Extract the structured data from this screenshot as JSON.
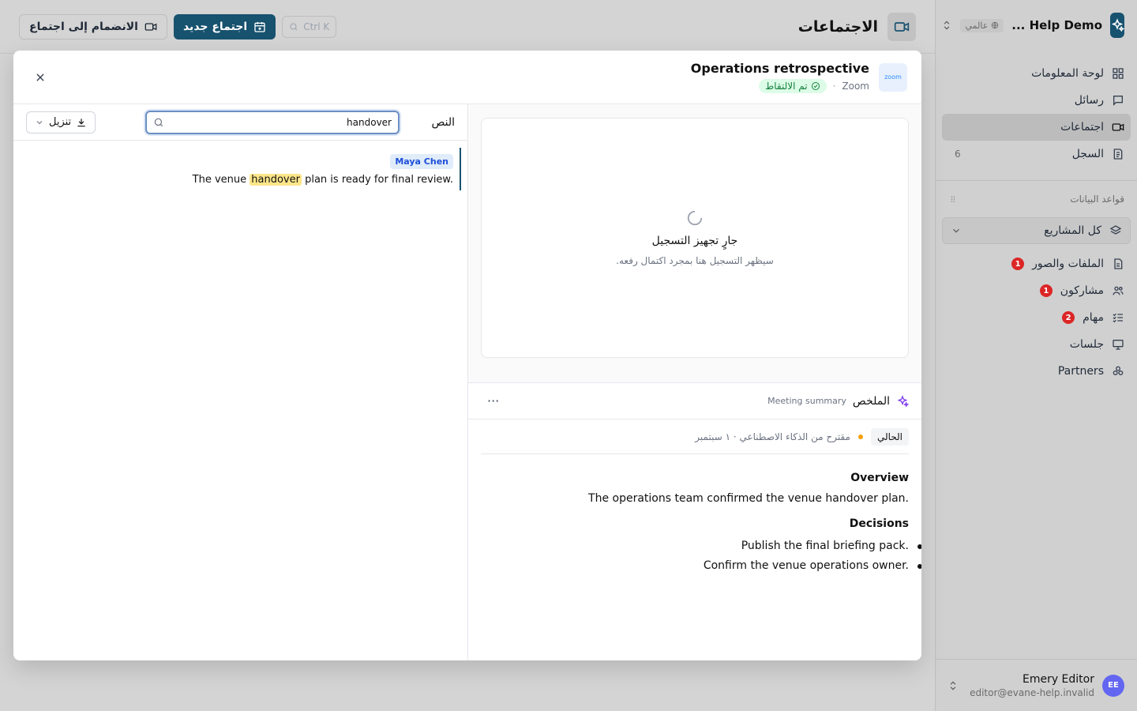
{
  "sidebar": {
    "workspace_name": "Help Demo ...",
    "workspace_scope": "عالمي",
    "nav": [
      {
        "label": "لوحة المعلومات",
        "icon": "dashboard-icon"
      },
      {
        "label": "رسائل",
        "icon": "message-icon"
      },
      {
        "label": "اجتماعات",
        "icon": "video-icon",
        "active": true
      },
      {
        "label": "السجل",
        "icon": "log-icon",
        "count": "6"
      }
    ],
    "databases_label": "قواعد البيانات",
    "project_select": "كل المشاريع",
    "db_items": [
      {
        "label": "الملفات والصور",
        "badge": "1",
        "icon": "file-icon"
      },
      {
        "label": "مشاركون",
        "badge": "1",
        "icon": "users-icon"
      },
      {
        "label": "مهام",
        "badge": "2",
        "icon": "tasks-icon"
      },
      {
        "label": "جلسات",
        "icon": "presentation-icon"
      },
      {
        "label": "Partners",
        "icon": "partners-icon"
      }
    ],
    "user": {
      "initials": "EE",
      "name": "Emery Editor",
      "email": "editor@evane-help.invalid"
    }
  },
  "topbar": {
    "title": "الاجتماعات",
    "shortcut": "Ctrl K",
    "new_meeting": "اجتماع جديد",
    "join_meeting": "الانضمام إلى اجتماع"
  },
  "modal": {
    "logo_text": "zoom",
    "title": "Operations retrospective",
    "platform": "Zoom",
    "status": "تم الالتقاط",
    "video": {
      "preparing": "جارٍ تجهيز التسجيل",
      "subtext": "سيظهر التسجيل هنا بمجرد اكتمال رفعه."
    },
    "summary": {
      "title": "الملخص",
      "subtitle": "Meeting summary",
      "more": "···",
      "version_label": "الحالي",
      "version_meta": "مقترح من الذكاء الاصطناعي · ١ سبتمبر",
      "overview_heading": "Overview",
      "overview_text": "The operations team confirmed the venue handover plan.",
      "decisions_heading": "Decisions",
      "decisions": [
        "Publish the final briefing pack.",
        "Confirm the venue operations owner."
      ]
    },
    "transcript": {
      "label": "النص",
      "search_value": "handover",
      "download": "تنزيل",
      "segments": [
        {
          "speaker": "Maya Chen",
          "before": "The venue ",
          "highlight": "handover",
          "after": " plan is ready for final review."
        }
      ]
    }
  },
  "colors": {
    "brand": "#17526f",
    "badge": "#dc2626",
    "highlight": "#fde68a",
    "captured": "#15803d"
  }
}
